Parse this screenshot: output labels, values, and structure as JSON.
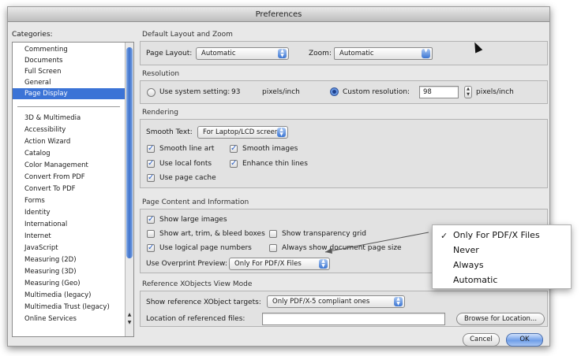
{
  "window": {
    "title": "Preferences"
  },
  "categories": {
    "label": "Categories:",
    "top_items": [
      "Commenting",
      "Documents",
      "Full Screen",
      "General",
      "Page Display"
    ],
    "items": [
      "3D & Multimedia",
      "Accessibility",
      "Action Wizard",
      "Catalog",
      "Color Management",
      "Convert From PDF",
      "Convert To PDF",
      "Forms",
      "Identity",
      "International",
      "Internet",
      "JavaScript",
      "Measuring (2D)",
      "Measuring (3D)",
      "Measuring (Geo)",
      "Multimedia (legacy)",
      "Multimedia Trust (legacy)",
      "Online Services"
    ],
    "selected": "Page Display"
  },
  "default_layout": {
    "section_title": "Default Layout and Zoom",
    "page_layout_label": "Page Layout:",
    "page_layout_value": "Automatic",
    "zoom_label": "Zoom:",
    "zoom_value": "Automatic"
  },
  "resolution": {
    "section_title": "Resolution",
    "system_setting_label": "Use system setting:",
    "system_value": "93",
    "system_unit": "pixels/inch",
    "custom_label": "Custom resolution:",
    "custom_value": "98",
    "custom_unit": "pixels/inch",
    "selected": "custom"
  },
  "rendering": {
    "section_title": "Rendering",
    "smooth_text_label": "Smooth Text:",
    "smooth_text_value": "For Laptop/LCD screens",
    "smooth_line_art": "Smooth line art",
    "smooth_images": "Smooth images",
    "use_local_fonts": "Use local fonts",
    "enhance_thin_lines": "Enhance thin lines",
    "use_page_cache": "Use page cache"
  },
  "page_content": {
    "section_title": "Page Content and Information",
    "show_large_images": "Show large images",
    "show_art_trim": "Show art, trim, & bleed boxes",
    "show_transparency_grid": "Show transparency grid",
    "use_logical_page_numbers": "Use logical page numbers",
    "always_show_doc_page_size": "Always show document page size",
    "overprint_label": "Use Overprint Preview:",
    "overprint_value": "Only For PDF/X Files"
  },
  "reference_xobjects": {
    "section_title": "Reference XObjects View Mode",
    "show_targets_label": "Show reference XObject targets:",
    "show_targets_value": "Only PDF/X-5 compliant ones",
    "location_label": "Location of referenced files:",
    "location_value": "",
    "browse_button": "Browse for Location..."
  },
  "buttons": {
    "cancel": "Cancel",
    "ok": "OK"
  },
  "overprint_menu": {
    "check_mark": "✓",
    "options": [
      "Only For PDF/X Files",
      "Never",
      "Always",
      "Automatic"
    ],
    "selected_index": 0
  },
  "icons": {
    "popup_arrows": "popup-arrows-icon",
    "checkmark": "checkmark-icon",
    "cursor": "mouse-pointer-icon"
  },
  "colors": {
    "selection": "#3b73d6",
    "accent": "#3b75d2"
  }
}
